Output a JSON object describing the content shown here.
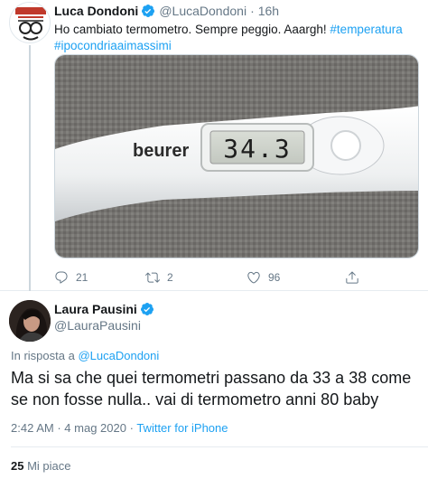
{
  "tweet": {
    "author": {
      "display_name": "Luca Dondoni",
      "handle": "@LucaDondoni",
      "time": "16h"
    },
    "text": "Ho cambiato termometro. Sempre peggio. Aaargh!",
    "hashtags": [
      "#temperatura",
      "#ipocondriaaimassimi"
    ],
    "thermometer": {
      "brand": "beurer",
      "reading": "34.3"
    },
    "actions": {
      "replies": "21",
      "retweets": "2",
      "likes": "96"
    }
  },
  "reply": {
    "author": {
      "display_name": "Laura Pausini",
      "handle": "@LauraPausini"
    },
    "replying_to_prefix": "In risposta a",
    "replying_to_handle": "@LucaDondoni",
    "text": "Ma si sa che quei termometri passano da 33 a 38 come se non fosse nulla.. vai di termometro anni 80 baby",
    "time": "2:42 AM",
    "date": "4 mag 2020",
    "separator": "·",
    "source": "Twitter for iPhone",
    "likes_count": "25",
    "likes_label": "Mi piace"
  },
  "colors": {
    "accent": "#1da1f2",
    "secondary_text": "#657786",
    "border": "#e6ecf0"
  },
  "icons": [
    "verified-badge-icon",
    "reply-icon",
    "retweet-icon",
    "like-icon",
    "share-icon"
  ]
}
